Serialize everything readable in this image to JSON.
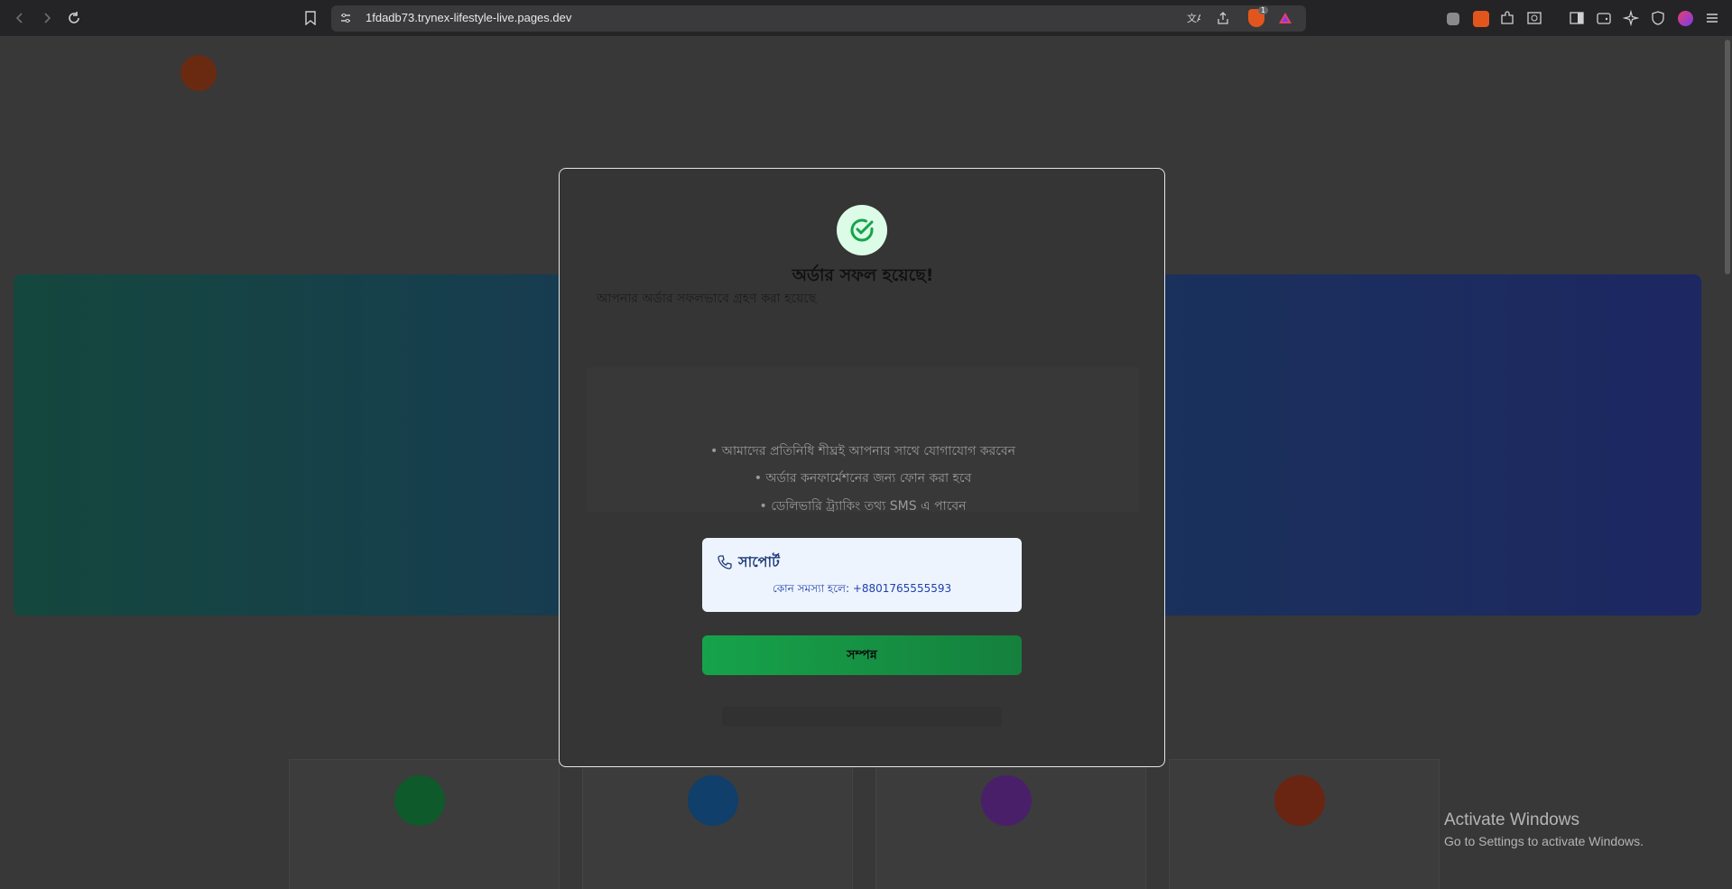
{
  "browser": {
    "url": "1fdadb73.trynex-lifestyle-live.pages.dev",
    "back_icon": "chevron-left-icon",
    "forward_icon": "chevron-right-icon",
    "reload_icon": "reload-icon",
    "shield_badge": "1"
  },
  "modal": {
    "title": "অর্ডার সফল হয়েছে!",
    "subtitle": "আপনার অর্ডার সফলভাবে গ্রহণ করা হয়েছে",
    "steps": [
      "• আমাদের প্রতিনিধি শীঘ্রই আপনার সাথে যোগাযোগ করবেন",
      "• অর্ডার কনফার্মেশনের জন্য ফোন করা হবে",
      "• ডেলিভারি ট্র্যাকিং তথ্য SMS এ পাবেন"
    ],
    "support": {
      "title": "সাপোর্ট",
      "text": "কোন সমস্যা হলে: +8801765555593"
    },
    "done_button": "সম্পন্ন"
  },
  "windows": {
    "activate_title": "Activate Windows",
    "activate_sub": "Go to Settings to activate Windows."
  },
  "colors": {
    "success": "#16a34a",
    "support_bg": "#eef4fd",
    "support_text": "#1e40af"
  }
}
